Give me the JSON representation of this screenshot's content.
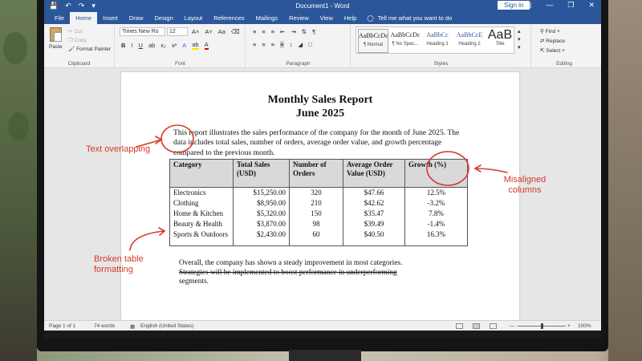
{
  "window": {
    "title": "Document1 - Word",
    "signin": "Sign in"
  },
  "tabs": [
    "File",
    "Home",
    "Insert",
    "Draw",
    "Design",
    "Layout",
    "References",
    "Mailings",
    "Review",
    "View",
    "Help"
  ],
  "tell_me": "Tell me what you want to do",
  "ribbon": {
    "clipboard": {
      "paste": "Paste",
      "cut": "Cut",
      "copy": "Copy",
      "format_painter": "Format Painter",
      "label": "Clipboard"
    },
    "font": {
      "name": "Times New Ro",
      "size": "12",
      "label": "Font"
    },
    "paragraph": {
      "label": "Paragraph"
    },
    "styles": {
      "label": "Styles",
      "items": [
        {
          "preview": "AaBbCcDc",
          "name": "¶ Normal"
        },
        {
          "preview": "AaBbCcDc",
          "name": "¶ No Spac..."
        },
        {
          "preview": "AaBbCc",
          "name": "Heading 1"
        },
        {
          "preview": "AaBbCcE",
          "name": "Heading 2"
        },
        {
          "preview": "AaB",
          "name": "Title"
        }
      ]
    },
    "editing": {
      "find": "Find",
      "replace": "Replace",
      "select": "Select",
      "label": "Editing"
    }
  },
  "document": {
    "title": "Monthly Sales Report",
    "subtitle": "June 2025",
    "intro": "This report illustrates the sales performance of the company for the month of June 2025. The data includes total sales, number of orders, average order value, and growth percentage compared to the previous month.",
    "table": {
      "headers": [
        "Category",
        "Total Sales (USD)",
        "Number of Orders",
        "Average Order Value (USD)",
        "Growth (%)"
      ],
      "rows": [
        [
          "Electronics",
          "$15,250.00",
          "320",
          "$47.66",
          "12.5%"
        ],
        [
          "Clothing",
          "$8,950.00",
          "210",
          "$42.62",
          "-3.2%"
        ],
        [
          "Home & Kitchen",
          "$5,320.00",
          "150",
          "$35.47",
          "7.8%"
        ],
        [
          "Beauty & Health",
          "$3,870.00",
          "98",
          "$39.49",
          "-1.4%"
        ],
        [
          "Sports & Outdoors",
          "$2,430.00",
          "60",
          "$40.50",
          "16.3%"
        ]
      ]
    },
    "summary_1": "Overall, the company has shown a steady improvement in most categories.",
    "summary_2": "Strategies will be implemented to boost performance in underperforming",
    "summary_3": "segments."
  },
  "status": {
    "page": "Page 1 of 1",
    "words": "74 words",
    "language": "English (United States)",
    "zoom": "100%"
  },
  "annotations": {
    "text_overlapping": "Text overlapping",
    "misaligned_columns": "Misaligned columns",
    "broken_table": "Broken table formatting",
    "color": "#d63a2a"
  }
}
